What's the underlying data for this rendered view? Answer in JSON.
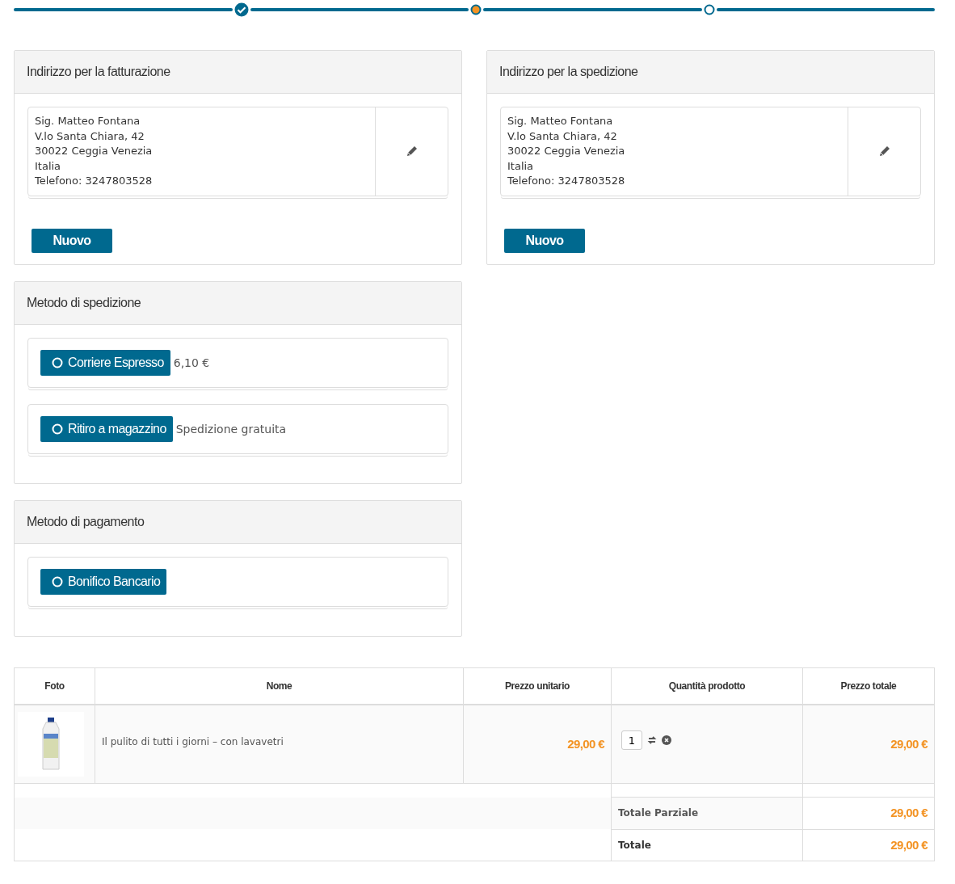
{
  "steps": [
    {
      "done": true,
      "selected": false
    },
    {
      "done": false,
      "selected": true
    },
    {
      "done": false,
      "selected": false
    }
  ],
  "billing": {
    "title": "Indirizzo per la fatturazione",
    "lines": [
      "Sig. Matteo Fontana",
      "V.lo Santa Chiara, 42",
      "30022 Ceggia Venezia",
      "Italia",
      "Telefono: 3247803528"
    ],
    "new_button": "Nuovo"
  },
  "shipping_address": {
    "title": "Indirizzo per la spedizione",
    "lines": [
      "Sig. Matteo Fontana",
      "V.lo Santa Chiara, 42",
      "30022 Ceggia Venezia",
      "Italia",
      "Telefono: 3247803528"
    ],
    "new_button": "Nuovo"
  },
  "shipping_method": {
    "title": "Metodo di spedizione",
    "options": [
      {
        "label": "Corriere Espresso",
        "note": "6,10 €",
        "selected": false
      },
      {
        "label": "Ritiro a magazzino",
        "note": "Spedizione gratuita",
        "selected": false
      }
    ]
  },
  "payment_method": {
    "title": "Metodo di pagamento",
    "options": [
      {
        "label": "Bonifico Bancario",
        "selected": false
      }
    ]
  },
  "cart": {
    "columns": [
      "Foto",
      "Nome",
      "Prezzo unitario",
      "Quantità prodotto",
      "Prezzo totale"
    ],
    "rows": [
      {
        "name": "Il pulito di tutti i giorni – con lavavetri",
        "unit_price": "29,00 €",
        "quantity": "1",
        "total": "29,00 €"
      }
    ],
    "summary": [
      {
        "label": "Totale Parziale",
        "value": "29,00 €"
      },
      {
        "label": "Totale",
        "value": "29,00 €"
      }
    ]
  }
}
